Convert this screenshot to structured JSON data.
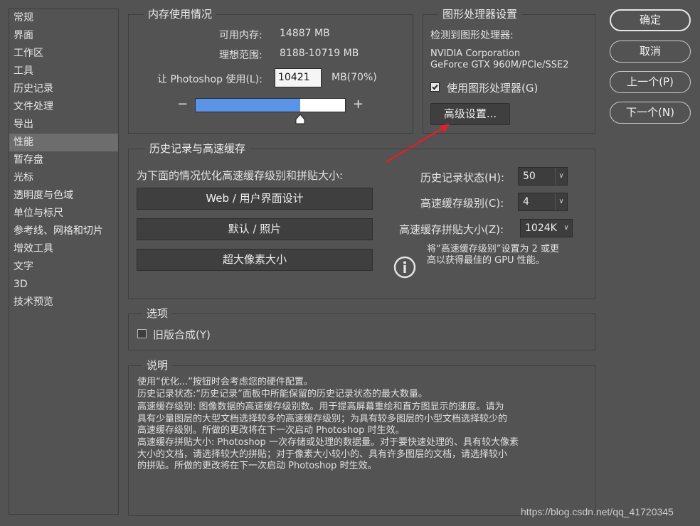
{
  "sidebar": {
    "items": [
      "常规",
      "界面",
      "工作区",
      "工具",
      "历史记录",
      "文件处理",
      "导出",
      "性能",
      "暂存盘",
      "光标",
      "透明度与色域",
      "单位与标尺",
      "参考线、网格和切片",
      "增效工具",
      "文字",
      "3D",
      "技术预览"
    ],
    "selected": "性能"
  },
  "memory": {
    "title": "内存使用情况",
    "available_label": "可用内存:",
    "available_value": "14887 MB",
    "ideal_label": "理想范围:",
    "ideal_value": "8188-10719 MB",
    "let_label": "让 Photoshop 使用(L):",
    "let_value": "10421",
    "let_unit": "MB(70%)",
    "minus": "−",
    "plus": "+",
    "slider_fraction": 0.7
  },
  "gpu": {
    "title": "图形处理器设置",
    "detected_label": "检测到图形处理器:",
    "vendor": "NVIDIA Corporation",
    "model": "GeForce GTX 960M/PCIe/SSE2",
    "use_gpu_label": "使用图形处理器(G)",
    "use_gpu_checked": true,
    "advanced_button": "高级设置..."
  },
  "buttons": {
    "ok": "确定",
    "cancel": "取消",
    "prev": "上一个(P)",
    "next": "下一个(N)"
  },
  "cache": {
    "title": "历史记录与高速缓存",
    "optimize_label": "为下面的情况优化高速缓存级别和拼贴大小:",
    "preset_web": "Web / 用户界面设计",
    "preset_default": "默认 / 照片",
    "preset_huge": "超大像素大小",
    "history_states_label": "历史记录状态(H):",
    "history_states_value": "50",
    "cache_levels_label": "高速缓存级别(C):",
    "cache_levels_value": "4",
    "cache_tile_label": "高速缓存拼贴大小(Z):",
    "cache_tile_value": "1024K",
    "info_line1": "将“高速缓存级别”设置为 2 或更",
    "info_line2": "高以获得最佳的 GPU 性能。"
  },
  "options": {
    "title": "选项",
    "legacy_label": "旧版合成(Y)",
    "legacy_checked": false
  },
  "description": {
    "title": "说明",
    "lines": [
      "使用“优化...”按钮时会考虑您的硬件配置。",
      "历史记录状态:“历史记录”面板中所能保留的历史记录状态的最大数量。",
      "高速缓存级别: 图像数据的高速缓存级别数。用于提高屏幕重绘和直方图显示的速度。请为",
      "具有少量图层的大型文档选择较多的高速缓存级别；为具有较多图层的小型文档选择较少的",
      "高速缓存级别。所做的更改将在下一次启动 Photoshop 时生效。",
      "高速缓存拼贴大小: Photoshop 一次存储或处理的数据量。对于要快速处理的、具有较大像素",
      "大小的文档，请选择较大的拼贴；对于像素大小较小的、具有许多图层的文档，请选择较小",
      "的拼贴。所做的更改将在下一次启动 Photoshop 时生效。"
    ]
  },
  "watermark": "https://blog.csdn.net/qq_41720345",
  "colors": {
    "background": "#535353",
    "slider_fill": "#5b93e6",
    "annotation_arrow": "#d9222a"
  }
}
